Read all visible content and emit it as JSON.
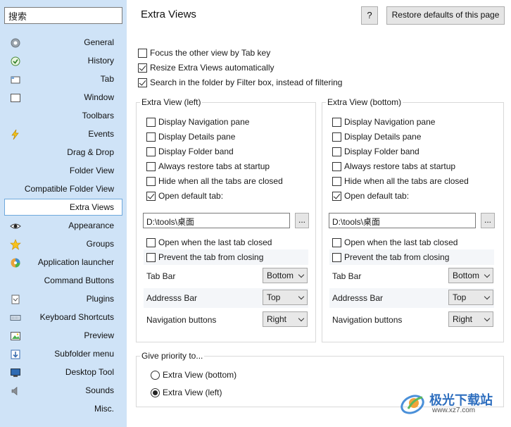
{
  "sidebar": {
    "search_value": "搜索",
    "items": [
      {
        "label": "General",
        "icon": "gear-icon"
      },
      {
        "label": "History",
        "icon": "history-icon"
      },
      {
        "label": "Tab",
        "icon": "tab-icon"
      },
      {
        "label": "Window",
        "icon": "window-icon"
      },
      {
        "label": "Toolbars",
        "icon": ""
      },
      {
        "label": "Events",
        "icon": "lightning-icon"
      },
      {
        "label": "Drag & Drop",
        "icon": ""
      },
      {
        "label": "Folder View",
        "icon": ""
      },
      {
        "label": "Compatible Folder View",
        "icon": ""
      },
      {
        "label": "Extra Views",
        "icon": ""
      },
      {
        "label": "Appearance",
        "icon": "eye-icon"
      },
      {
        "label": "Groups",
        "icon": "star-icon"
      },
      {
        "label": "Application launcher",
        "icon": "launcher-icon"
      },
      {
        "label": "Command Buttons",
        "icon": ""
      },
      {
        "label": "Plugins",
        "icon": "plugin-icon"
      },
      {
        "label": "Keyboard Shortcuts",
        "icon": "keyboard-icon"
      },
      {
        "label": "Preview",
        "icon": "preview-icon"
      },
      {
        "label": "Subfolder menu",
        "icon": "subfolder-icon"
      },
      {
        "label": "Desktop Tool",
        "icon": "desktop-icon"
      },
      {
        "label": "Sounds",
        "icon": "speaker-icon"
      },
      {
        "label": "Misc.",
        "icon": ""
      }
    ],
    "active_item": "Extra Views",
    "bg_color": "#cfe3f7"
  },
  "header": {
    "title": "Extra Views",
    "help_label": "?",
    "restore_label": "Restore defaults of this page"
  },
  "general_options": [
    {
      "label": "Focus the other view by Tab key",
      "checked": false
    },
    {
      "label": "Resize Extra Views automatically",
      "checked": true
    },
    {
      "label": "Search in the folder by Filter box, instead of filtering",
      "checked": true
    }
  ],
  "left_panel": {
    "title": "Extra View (left)",
    "options": [
      {
        "label": "Display Navigation pane",
        "checked": false
      },
      {
        "label": "Display Details pane",
        "checked": false
      },
      {
        "label": "Display Folder band",
        "checked": false
      },
      {
        "label": "Always restore tabs at startup",
        "checked": false
      },
      {
        "label": "Hide when all the tabs are closed",
        "checked": false
      },
      {
        "label": "Open default tab:",
        "checked": true
      }
    ],
    "path_value": "D:\\tools\\桌面",
    "browse_label": "...",
    "close_options": [
      {
        "label": "Open when the last tab closed",
        "checked": false
      },
      {
        "label": "Prevent the tab from closing",
        "checked": false
      }
    ],
    "bars": [
      {
        "label": "Tab Bar",
        "value": "Bottom"
      },
      {
        "label": "Addresss Bar",
        "value": "Top"
      },
      {
        "label": "Navigation buttons",
        "value": "Right"
      }
    ]
  },
  "bottom_panel": {
    "title": "Extra View (bottom)",
    "options": [
      {
        "label": "Display Navigation pane",
        "checked": false
      },
      {
        "label": "Display Details pane",
        "checked": false
      },
      {
        "label": "Display Folder band",
        "checked": false
      },
      {
        "label": "Always restore tabs at startup",
        "checked": false
      },
      {
        "label": "Hide when all the tabs are closed",
        "checked": false
      },
      {
        "label": "Open default tab:",
        "checked": true
      }
    ],
    "path_value": "D:\\tools\\桌面",
    "browse_label": "...",
    "close_options": [
      {
        "label": "Open when the last tab closed",
        "checked": false
      },
      {
        "label": "Prevent the tab from closing",
        "checked": false
      }
    ],
    "bars": [
      {
        "label": "Tab Bar",
        "value": "Bottom"
      },
      {
        "label": "Addresss Bar",
        "value": "Top"
      },
      {
        "label": "Navigation buttons",
        "value": "Right"
      }
    ]
  },
  "priority": {
    "title": "Give priority to...",
    "options": [
      {
        "label": "Extra View (bottom)",
        "selected": false
      },
      {
        "label": "Extra View (left)",
        "selected": true
      }
    ]
  },
  "watermark": {
    "text": "极光下载站",
    "url_text": "www.xz7.com"
  }
}
